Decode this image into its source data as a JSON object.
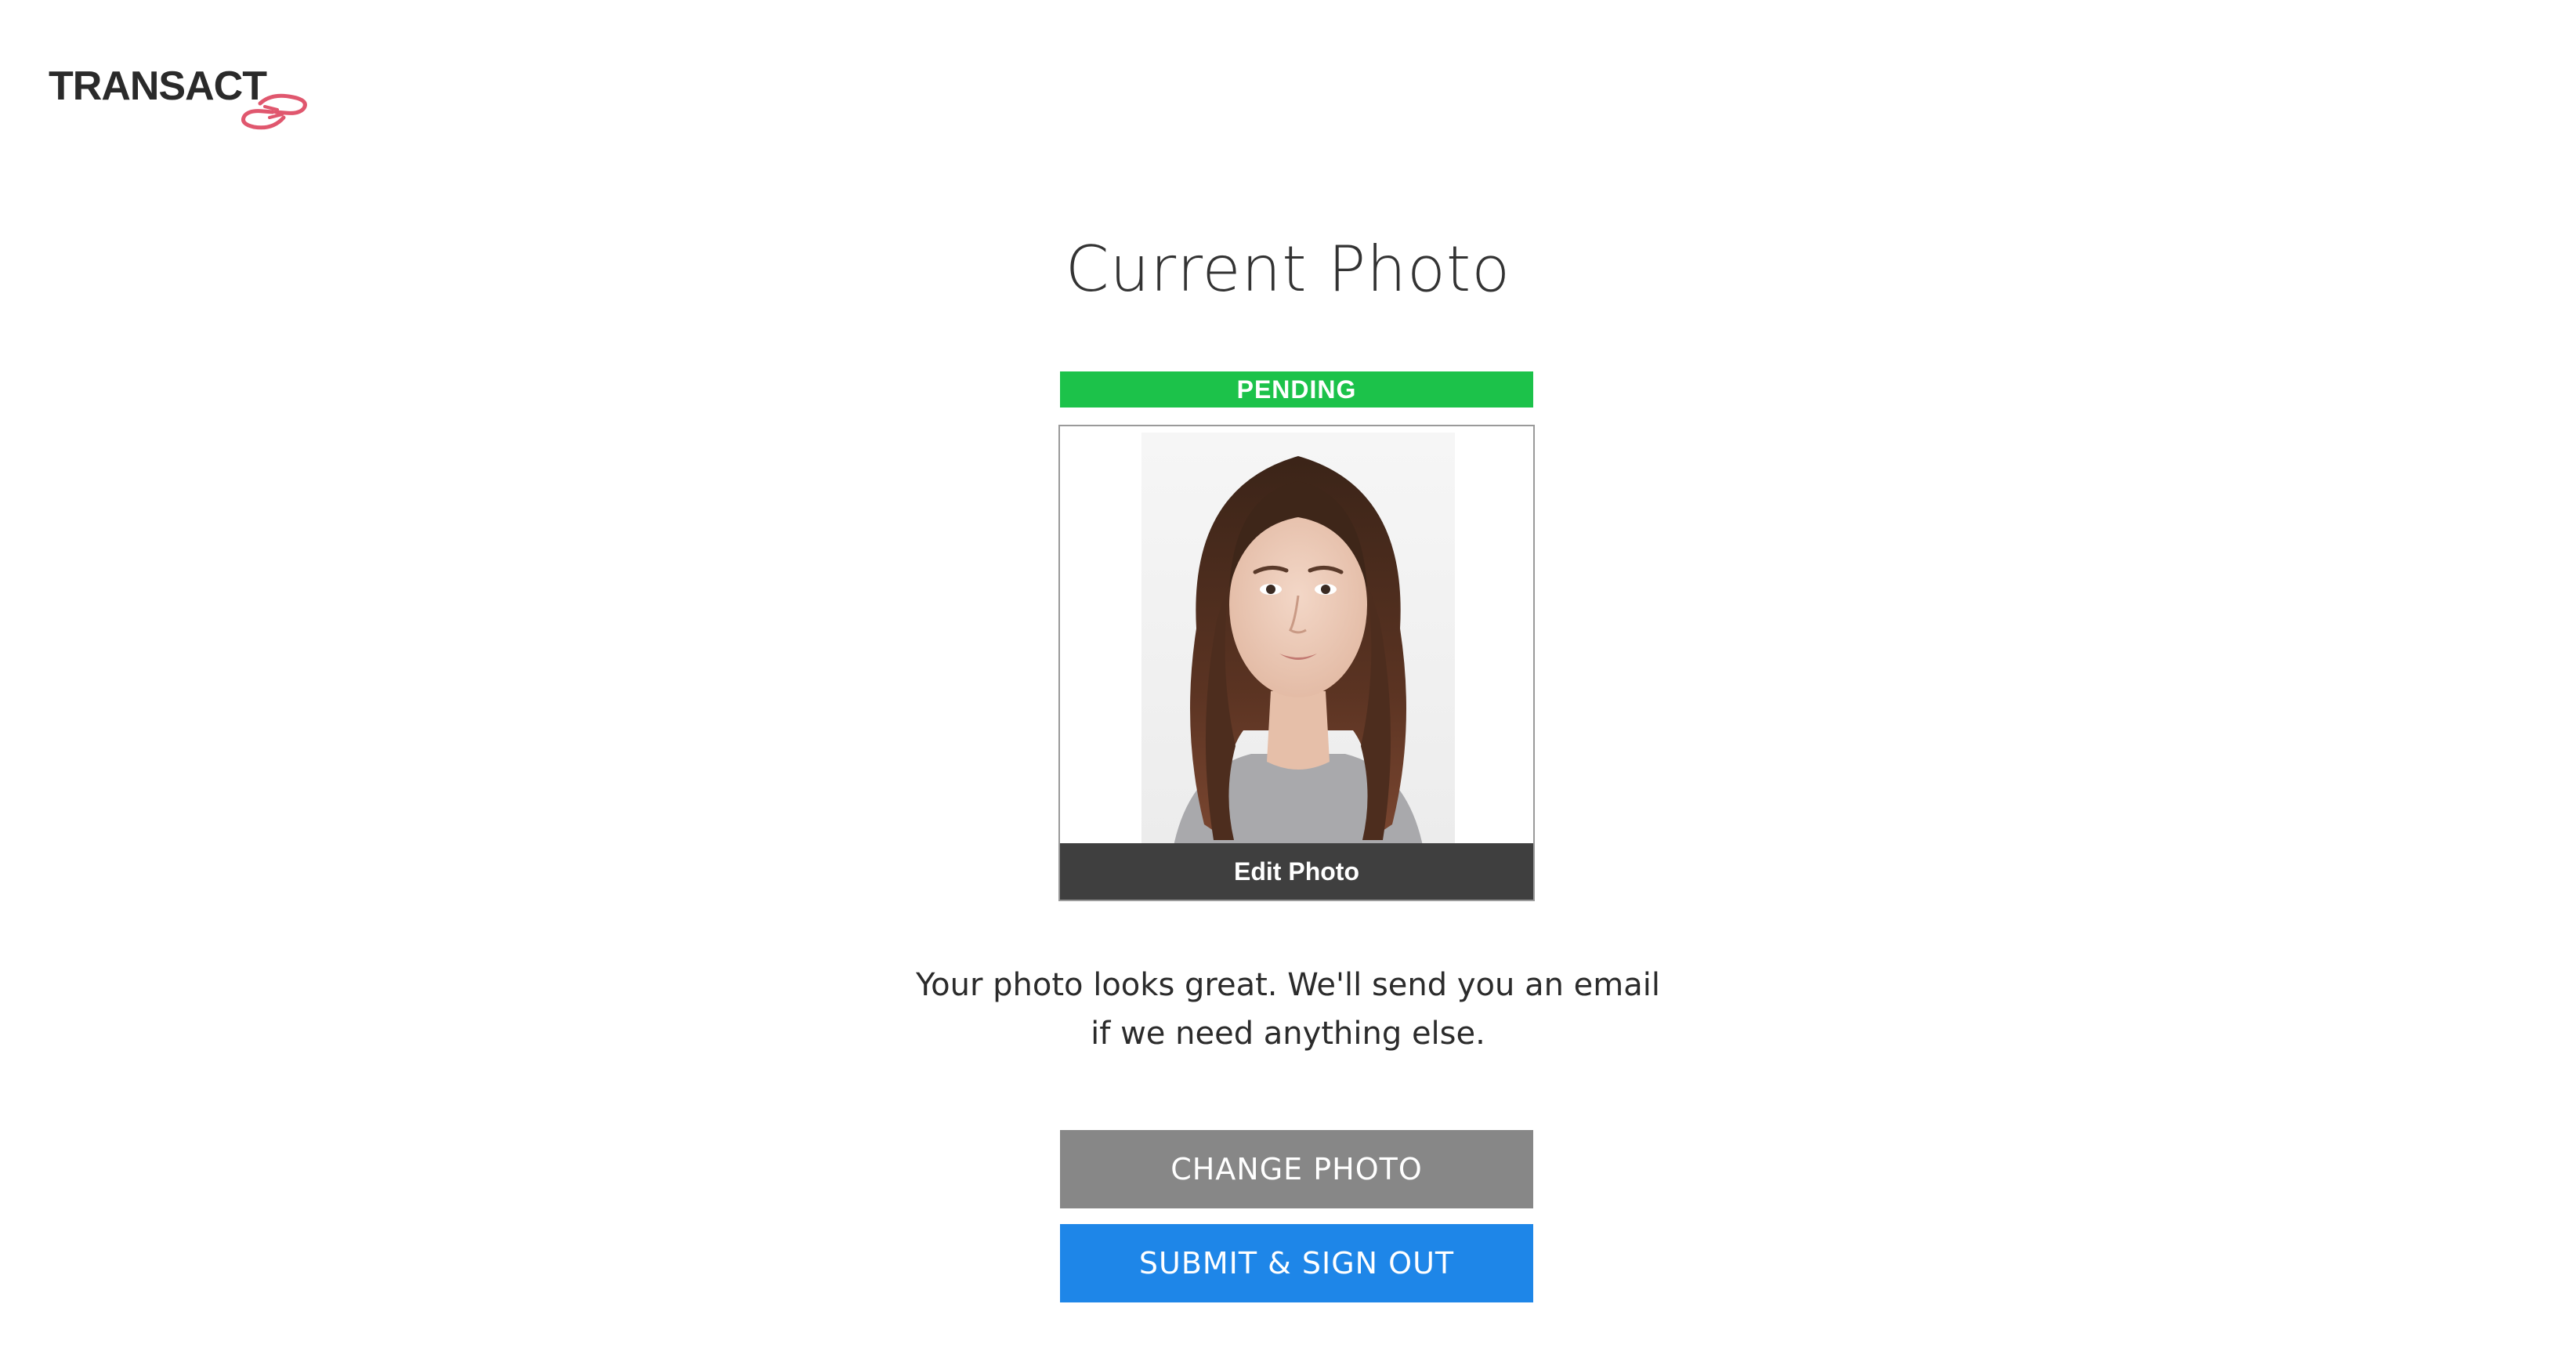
{
  "brand": {
    "name": "TRANSACT",
    "accent_color": "#e0576e"
  },
  "page": {
    "title": "Current Photo"
  },
  "status": {
    "label": "PENDING",
    "color": "#1cc24a"
  },
  "photo": {
    "edit_label": "Edit Photo",
    "icon": "portrait-photo"
  },
  "message": {
    "line1": "Your photo looks great. We'll send you an email",
    "line2": "if we need anything else."
  },
  "actions": {
    "change_photo_label": "CHANGE PHOTO",
    "change_photo_color": "#878787",
    "submit_label": "SUBMIT & SIGN OUT",
    "submit_color": "#1e86e8"
  }
}
